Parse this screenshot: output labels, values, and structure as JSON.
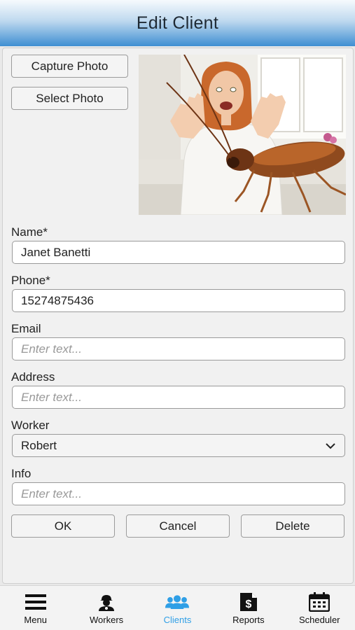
{
  "header": {
    "title": "Edit Client"
  },
  "photo_buttons": {
    "capture": "Capture Photo",
    "select": "Select Photo"
  },
  "form": {
    "name_label": "Name*",
    "name_value": "Janet Banetti",
    "phone_label": "Phone*",
    "phone_value": "15274875436",
    "email_label": "Email",
    "email_placeholder": "Enter text...",
    "address_label": "Address",
    "address_placeholder": "Enter text...",
    "worker_label": "Worker",
    "worker_value": "Robert",
    "info_label": "Info",
    "info_placeholder": "Enter text..."
  },
  "actions": {
    "ok": "OK",
    "cancel": "Cancel",
    "delete": "Delete"
  },
  "tabs": [
    {
      "label": "Menu",
      "icon": "menu-icon"
    },
    {
      "label": "Workers",
      "icon": "workers-icon"
    },
    {
      "label": "Clients",
      "icon": "clients-icon"
    },
    {
      "label": "Reports",
      "icon": "reports-icon"
    },
    {
      "label": "Scheduler",
      "icon": "scheduler-icon"
    }
  ],
  "colors": {
    "accent": "#2f9fe6",
    "header_bottom": "#3f8fd2"
  }
}
